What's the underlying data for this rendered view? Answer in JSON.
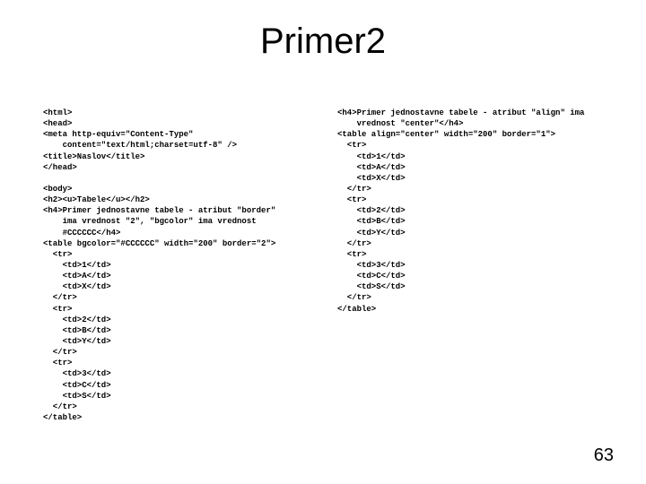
{
  "title": "Primer2",
  "page_number": "63",
  "col_left": "<html>\n<head>\n<meta http-equiv=\"Content-Type\"\n    content=\"text/html;charset=utf-8\" />\n<title>Naslov</title>\n</head>\n\n<body>\n<h2><u>Tabele</u></h2>\n<h4>Primer jednostavne tabele - atribut \"border\"\n    ima vrednost \"2\", \"bgcolor\" ima vrednost\n    #CCCCCC</h4>\n<table bgcolor=\"#CCCCCC\" width=\"200\" border=\"2\">\n  <tr>\n    <td>1</td>\n    <td>A</td>\n    <td>X</td>\n  </tr>\n  <tr>\n    <td>2</td>\n    <td>B</td>\n    <td>Y</td>\n  </tr>\n  <tr>\n    <td>3</td>\n    <td>C</td>\n    <td>S</td>\n  </tr>\n</table>",
  "col_right": "<h4>Primer jednostavne tabele - atribut \"align\" ima\n    vrednost \"center\"</h4>\n<table align=\"center\" width=\"200\" border=\"1\">\n  <tr>\n    <td>1</td>\n    <td>A</td>\n    <td>X</td>\n  </tr>\n  <tr>\n    <td>2</td>\n    <td>B</td>\n    <td>Y</td>\n  </tr>\n  <tr>\n    <td>3</td>\n    <td>C</td>\n    <td>S</td>\n  </tr>\n</table>"
}
